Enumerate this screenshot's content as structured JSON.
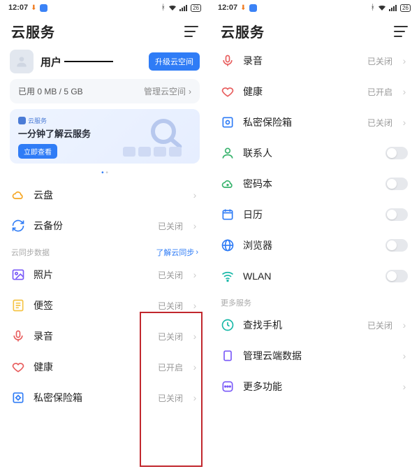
{
  "status": {
    "time": "12:07",
    "battery": "26"
  },
  "header": {
    "title": "云服务"
  },
  "user": {
    "name_prefix": "用户",
    "upgrade_label": "升级云空间"
  },
  "storage": {
    "usage": "已用 0 MB / 5 GB",
    "manage": "管理云空间"
  },
  "promo": {
    "tag": "云服务",
    "title": "一分钟了解云服务",
    "cta": "立即查看"
  },
  "left_basic": [
    {
      "label": "云盘",
      "status": ""
    },
    {
      "label": "云备份",
      "status": "已关闭"
    }
  ],
  "sync_header": {
    "title": "云同步数据",
    "link": "了解云同步"
  },
  "left_sync": [
    {
      "label": "照片",
      "status": "已关闭"
    },
    {
      "label": "便签",
      "status": "已关闭"
    },
    {
      "label": "录音",
      "status": "已关闭"
    },
    {
      "label": "健康",
      "status": "已开启"
    },
    {
      "label": "私密保险箱",
      "status": "已关闭"
    }
  ],
  "right_sync": [
    {
      "label": "录音",
      "status": "已关闭"
    },
    {
      "label": "健康",
      "status": "已开启"
    },
    {
      "label": "私密保险箱",
      "status": "已关闭"
    }
  ],
  "right_toggles": [
    {
      "label": "联系人"
    },
    {
      "label": "密码本"
    },
    {
      "label": "日历"
    },
    {
      "label": "浏览器"
    },
    {
      "label": "WLAN"
    }
  ],
  "more_header": "更多服务",
  "right_more": [
    {
      "label": "查找手机",
      "status": "已关闭",
      "chevron": true
    },
    {
      "label": "管理云端数据",
      "status": "",
      "chevron": true
    },
    {
      "label": "更多功能",
      "status": "",
      "chevron": true
    }
  ]
}
